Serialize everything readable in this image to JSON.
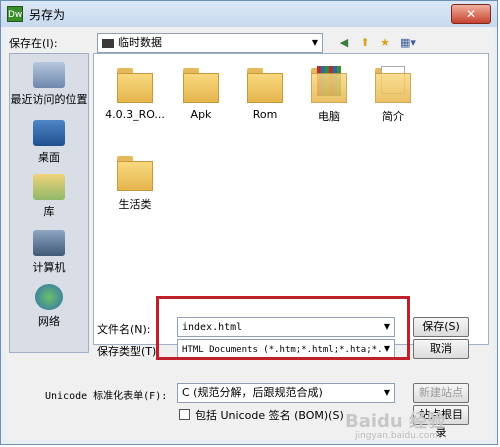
{
  "window": {
    "app_icon": "Dw",
    "title": "另存为",
    "close_label": "✕"
  },
  "save_in": {
    "label": "保存在(I):",
    "value": "临时数据"
  },
  "places": [
    {
      "label": "最近访问的位置",
      "icon": "recent-places-icon"
    },
    {
      "label": "桌面",
      "icon": "desktop-icon"
    },
    {
      "label": "库",
      "icon": "libraries-icon"
    },
    {
      "label": "计算机",
      "icon": "computer-icon"
    },
    {
      "label": "网络",
      "icon": "network-icon"
    }
  ],
  "folders": [
    {
      "label": "4.0.3_RO..."
    },
    {
      "label": "Apk"
    },
    {
      "label": "Rom"
    },
    {
      "label": "电脑"
    },
    {
      "label": "简介"
    },
    {
      "label": "生活类"
    }
  ],
  "file_name": {
    "label": "文件名(N):",
    "value": "index.html"
  },
  "file_type": {
    "label": "保存类型(T):",
    "value": "HTML Documents (*.htm;*.html;*.hta;*."
  },
  "unicode_form": {
    "label": "Unicode 标准化表单(F):",
    "value": "C (规范分解，后跟规范合成)"
  },
  "bom": {
    "label": "包括 Unicode 签名 (BOM)(S)"
  },
  "buttons": {
    "save": "保存(S)",
    "cancel": "取消",
    "new_site": "新建站点",
    "site_root": "站点根目录"
  },
  "watermark": {
    "brand": "Baidu 经验",
    "url": "jingyan.baidu.com"
  }
}
